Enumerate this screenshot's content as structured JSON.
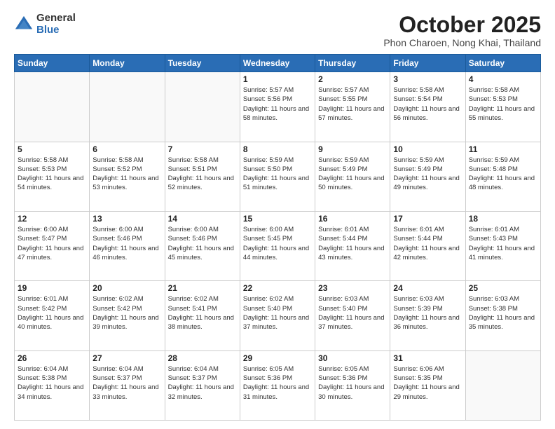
{
  "header": {
    "logo_general": "General",
    "logo_blue": "Blue",
    "month": "October 2025",
    "location": "Phon Charoen, Nong Khai, Thailand"
  },
  "days_of_week": [
    "Sunday",
    "Monday",
    "Tuesday",
    "Wednesday",
    "Thursday",
    "Friday",
    "Saturday"
  ],
  "weeks": [
    [
      {
        "day": null
      },
      {
        "day": null
      },
      {
        "day": null
      },
      {
        "day": "1",
        "sunrise": "5:57 AM",
        "sunset": "5:56 PM",
        "daylight": "11 hours and 58 minutes."
      },
      {
        "day": "2",
        "sunrise": "5:57 AM",
        "sunset": "5:55 PM",
        "daylight": "11 hours and 57 minutes."
      },
      {
        "day": "3",
        "sunrise": "5:58 AM",
        "sunset": "5:54 PM",
        "daylight": "11 hours and 56 minutes."
      },
      {
        "day": "4",
        "sunrise": "5:58 AM",
        "sunset": "5:53 PM",
        "daylight": "11 hours and 55 minutes."
      }
    ],
    [
      {
        "day": "5",
        "sunrise": "5:58 AM",
        "sunset": "5:53 PM",
        "daylight": "11 hours and 54 minutes."
      },
      {
        "day": "6",
        "sunrise": "5:58 AM",
        "sunset": "5:52 PM",
        "daylight": "11 hours and 53 minutes."
      },
      {
        "day": "7",
        "sunrise": "5:58 AM",
        "sunset": "5:51 PM",
        "daylight": "11 hours and 52 minutes."
      },
      {
        "day": "8",
        "sunrise": "5:59 AM",
        "sunset": "5:50 PM",
        "daylight": "11 hours and 51 minutes."
      },
      {
        "day": "9",
        "sunrise": "5:59 AM",
        "sunset": "5:49 PM",
        "daylight": "11 hours and 50 minutes."
      },
      {
        "day": "10",
        "sunrise": "5:59 AM",
        "sunset": "5:49 PM",
        "daylight": "11 hours and 49 minutes."
      },
      {
        "day": "11",
        "sunrise": "5:59 AM",
        "sunset": "5:48 PM",
        "daylight": "11 hours and 48 minutes."
      }
    ],
    [
      {
        "day": "12",
        "sunrise": "6:00 AM",
        "sunset": "5:47 PM",
        "daylight": "11 hours and 47 minutes."
      },
      {
        "day": "13",
        "sunrise": "6:00 AM",
        "sunset": "5:46 PM",
        "daylight": "11 hours and 46 minutes."
      },
      {
        "day": "14",
        "sunrise": "6:00 AM",
        "sunset": "5:46 PM",
        "daylight": "11 hours and 45 minutes."
      },
      {
        "day": "15",
        "sunrise": "6:00 AM",
        "sunset": "5:45 PM",
        "daylight": "11 hours and 44 minutes."
      },
      {
        "day": "16",
        "sunrise": "6:01 AM",
        "sunset": "5:44 PM",
        "daylight": "11 hours and 43 minutes."
      },
      {
        "day": "17",
        "sunrise": "6:01 AM",
        "sunset": "5:44 PM",
        "daylight": "11 hours and 42 minutes."
      },
      {
        "day": "18",
        "sunrise": "6:01 AM",
        "sunset": "5:43 PM",
        "daylight": "11 hours and 41 minutes."
      }
    ],
    [
      {
        "day": "19",
        "sunrise": "6:01 AM",
        "sunset": "5:42 PM",
        "daylight": "11 hours and 40 minutes."
      },
      {
        "day": "20",
        "sunrise": "6:02 AM",
        "sunset": "5:42 PM",
        "daylight": "11 hours and 39 minutes."
      },
      {
        "day": "21",
        "sunrise": "6:02 AM",
        "sunset": "5:41 PM",
        "daylight": "11 hours and 38 minutes."
      },
      {
        "day": "22",
        "sunrise": "6:02 AM",
        "sunset": "5:40 PM",
        "daylight": "11 hours and 37 minutes."
      },
      {
        "day": "23",
        "sunrise": "6:03 AM",
        "sunset": "5:40 PM",
        "daylight": "11 hours and 37 minutes."
      },
      {
        "day": "24",
        "sunrise": "6:03 AM",
        "sunset": "5:39 PM",
        "daylight": "11 hours and 36 minutes."
      },
      {
        "day": "25",
        "sunrise": "6:03 AM",
        "sunset": "5:38 PM",
        "daylight": "11 hours and 35 minutes."
      }
    ],
    [
      {
        "day": "26",
        "sunrise": "6:04 AM",
        "sunset": "5:38 PM",
        "daylight": "11 hours and 34 minutes."
      },
      {
        "day": "27",
        "sunrise": "6:04 AM",
        "sunset": "5:37 PM",
        "daylight": "11 hours and 33 minutes."
      },
      {
        "day": "28",
        "sunrise": "6:04 AM",
        "sunset": "5:37 PM",
        "daylight": "11 hours and 32 minutes."
      },
      {
        "day": "29",
        "sunrise": "6:05 AM",
        "sunset": "5:36 PM",
        "daylight": "11 hours and 31 minutes."
      },
      {
        "day": "30",
        "sunrise": "6:05 AM",
        "sunset": "5:36 PM",
        "daylight": "11 hours and 30 minutes."
      },
      {
        "day": "31",
        "sunrise": "6:06 AM",
        "sunset": "5:35 PM",
        "daylight": "11 hours and 29 minutes."
      },
      {
        "day": null
      }
    ]
  ]
}
